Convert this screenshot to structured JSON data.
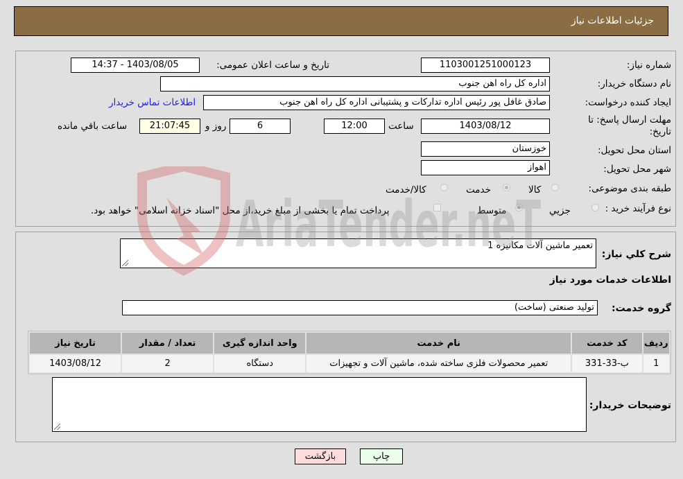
{
  "header": {
    "title": "جزئیات اطلاعات نیاز"
  },
  "info": {
    "need_number_label": "شماره نیاز:",
    "need_number": "1103001251000123",
    "announce_label": "تاریخ و ساعت اعلان عمومی:",
    "announce_value": "1403/08/05 - 14:37",
    "buyer_org_label": "نام دستگاه خریدار:",
    "buyer_org": "اداره کل راه اهن جنوب",
    "creator_label": "ایجاد کننده درخواست:",
    "creator": "صادق غافل پور رئیس اداره تدارکات و پشتیبانی اداره کل راه اهن جنوب",
    "contact_link": "اطلاعات تماس خریدار",
    "deadline_label_1": "مهلت ارسال پاسخ: تا",
    "deadline_label_2": "تاریخ:",
    "deadline_date": "1403/08/12",
    "time_label": "ساعت",
    "deadline_time": "12:00",
    "days": "6",
    "days_label": "روز و",
    "remaining_time": "21:07:45",
    "remaining_label": "ساعت باقي مانده",
    "province_label": "استان محل تحویل:",
    "province": "خوزستان",
    "city_label": "شهر محل تحویل:",
    "city": "اهواز",
    "category_label": "طبقه بندی موضوعی:",
    "category_options": [
      {
        "label": "کالا",
        "checked": false
      },
      {
        "label": "خدمت",
        "checked": true
      },
      {
        "label": "کالا/خدمت",
        "checked": false
      }
    ],
    "process_label": "نوع فرآیند خرید :",
    "process_options": [
      {
        "label": "جزیي",
        "checked": false
      },
      {
        "label": "متوسط",
        "checked": true
      }
    ],
    "payment_note": "پرداخت تمام یا بخشی از مبلغ خرید،از محل \"اسناد خزانه اسلامی\" خواهد بود."
  },
  "details": {
    "description_label": "شرح کلي نیاز:",
    "description": "تعمیر ماشین آلات مکانیزه 1",
    "services_heading": "اطلاعات خدمات مورد نیاز",
    "service_group_label": "گروه خدمت:",
    "service_group": "تولید صنعتی (ساخت)",
    "table": {
      "headers": [
        "ردیف",
        "کد خدمت",
        "نام خدمت",
        "واحد اندازه گیری",
        "تعداد / مقدار",
        "تاریخ نیاز"
      ],
      "rows": [
        [
          "1",
          "ب-33-331",
          "تعمیر محصولات فلزی ساخته شده، ماشین آلات و تجهیزات",
          "دستگاه",
          "2",
          "1403/08/12"
        ]
      ]
    },
    "buyer_notes_label": "توضیحات خریدار:",
    "buyer_notes": ""
  },
  "buttons": {
    "print": "چاپ",
    "back": "بازگشت"
  },
  "watermark": {
    "text": "AriaTender.neT"
  },
  "colors": {
    "header_bg": "#8b6d43",
    "print_btn": "#eaffea",
    "back_btn": "#ffdcdc",
    "link": "#1a1aff"
  }
}
